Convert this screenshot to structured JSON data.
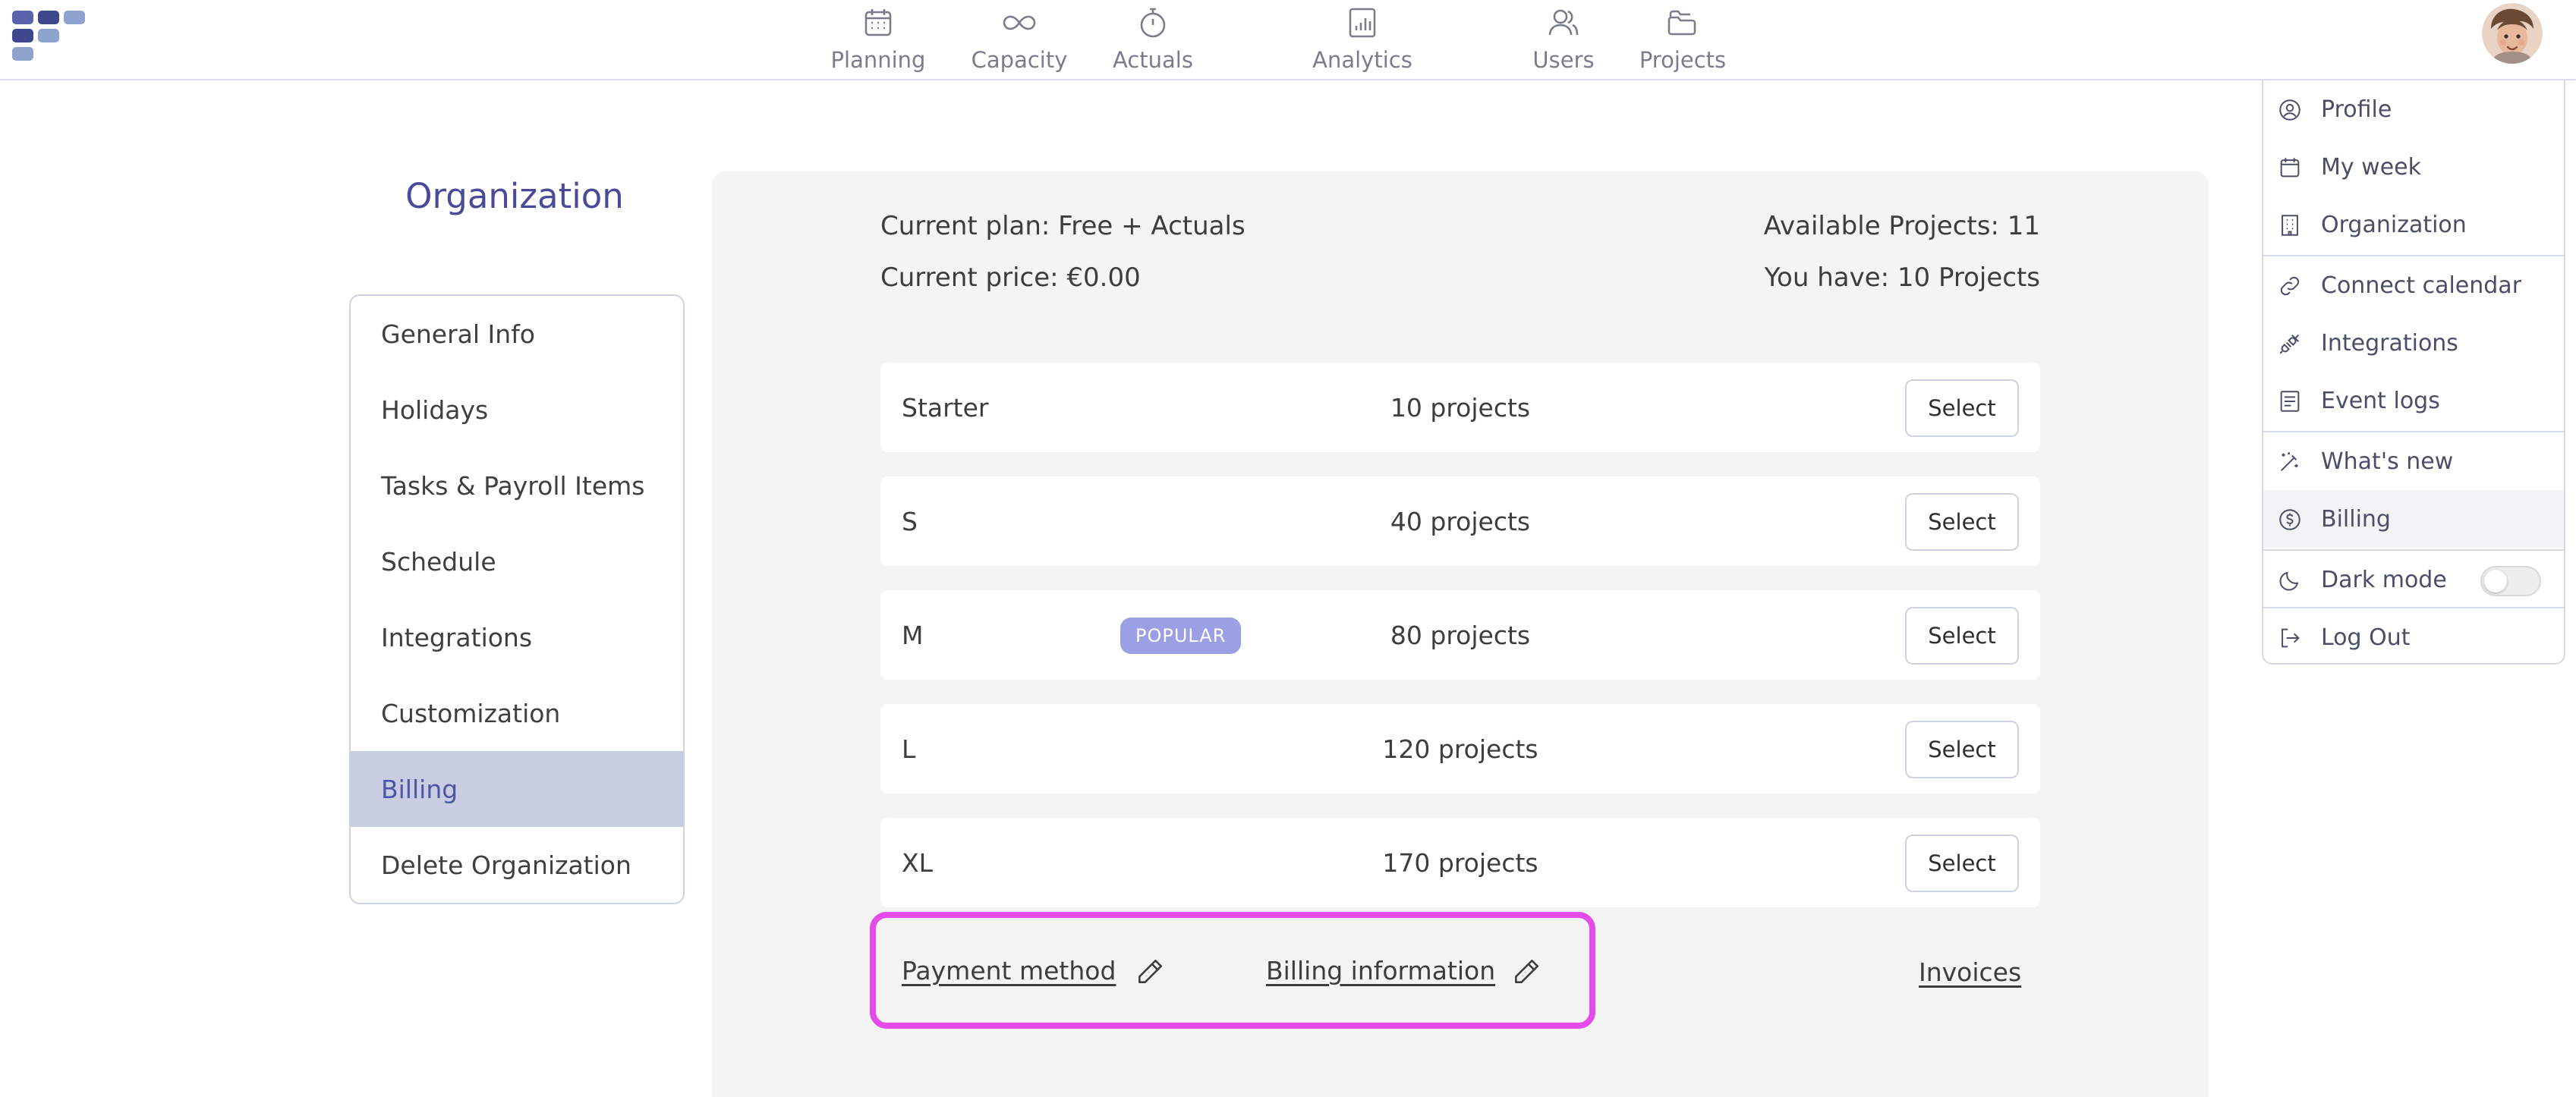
{
  "nav": {
    "items": [
      {
        "label": "Planning",
        "icon": "calendar-icon"
      },
      {
        "label": "Capacity",
        "icon": "infinity-icon"
      },
      {
        "label": "Actuals",
        "icon": "stopwatch-icon"
      },
      {
        "label": "Analytics",
        "icon": "bar-chart-icon"
      },
      {
        "label": "Users",
        "icon": "users-icon"
      },
      {
        "label": "Projects",
        "icon": "folders-icon"
      }
    ]
  },
  "sidebar": {
    "title": "Organization",
    "items": [
      {
        "label": "General Info"
      },
      {
        "label": "Holidays"
      },
      {
        "label": "Tasks & Payroll Items"
      },
      {
        "label": "Schedule"
      },
      {
        "label": "Integrations"
      },
      {
        "label": "Customization"
      },
      {
        "label": "Billing",
        "active": true
      },
      {
        "label": "Delete Organization"
      }
    ]
  },
  "billing": {
    "current_plan": "Current plan: Free + Actuals",
    "current_price": "Current price: €0.00",
    "available_projects": "Available Projects: 11",
    "you_have": "You have: 10 Projects",
    "plans": [
      {
        "name": "Starter",
        "projects": "10 projects",
        "button": "Select"
      },
      {
        "name": "S",
        "projects": "40 projects",
        "button": "Select"
      },
      {
        "name": "M",
        "projects": "80 projects",
        "button": "Select",
        "badge": "POPULAR"
      },
      {
        "name": "L",
        "projects": "120 projects",
        "button": "Select"
      },
      {
        "name": "XL",
        "projects": "170 projects",
        "button": "Select"
      }
    ],
    "payment_method": "Payment method",
    "billing_information": "Billing information",
    "invoices": "Invoices"
  },
  "user_menu": {
    "items": [
      {
        "label": "Profile",
        "icon": "user-circle-icon"
      },
      {
        "label": "My week",
        "icon": "calendar-icon"
      },
      {
        "label": "Organization",
        "icon": "building-icon"
      },
      {
        "label": "Connect calendar",
        "icon": "link-icon"
      },
      {
        "label": "Integrations",
        "icon": "plug-icon"
      },
      {
        "label": "Event logs",
        "icon": "log-icon"
      },
      {
        "label": "What's new",
        "icon": "magic-wand-icon"
      },
      {
        "label": "Billing",
        "icon": "dollar-circle-icon",
        "active": true
      },
      {
        "label": "Dark mode",
        "icon": "moon-icon",
        "toggle": false
      },
      {
        "label": "Log Out",
        "icon": "logout-icon"
      }
    ]
  },
  "colors": {
    "accent": "#4a4a9a",
    "active_bg": "#c8cde2",
    "badge": "#9b9fe3",
    "highlight": "#e54be8",
    "panel_bg": "#f4f4f4"
  }
}
